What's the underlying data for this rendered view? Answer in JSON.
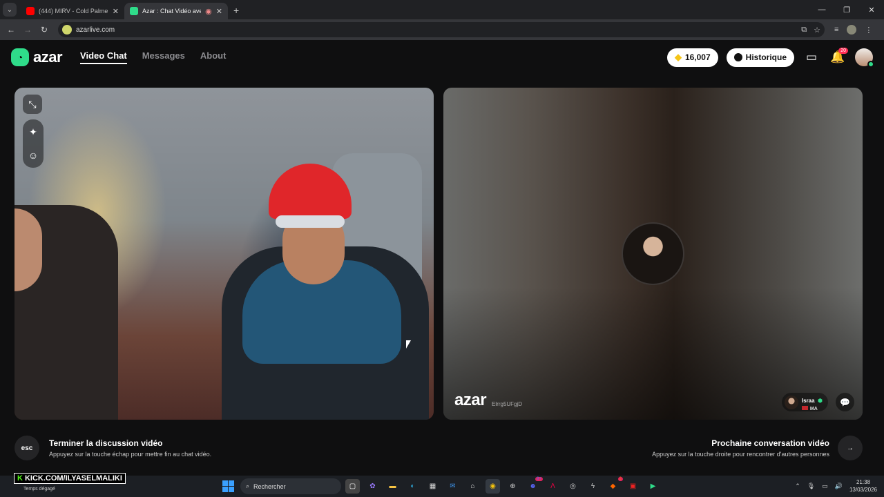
{
  "browser": {
    "tabs": [
      {
        "title": "(444) MIRV - Cold Palmer (offic",
        "icon": "youtube-icon",
        "color": "#ff0000"
      },
      {
        "title": "Azar : Chat Vidéo avec de n",
        "icon": "azar-favicon",
        "color": "#2fdc8a"
      }
    ],
    "url": "azarlive.com"
  },
  "header": {
    "logo": "azar",
    "nav": [
      {
        "label": "Video Chat",
        "active": true
      },
      {
        "label": "Messages",
        "active": false
      },
      {
        "label": "About",
        "active": false
      }
    ],
    "gems": "16,007",
    "history_label": "Historique",
    "notification_count": "20"
  },
  "remote": {
    "watermark": "azar",
    "session_id": "Elrrg5UFgjD",
    "peer_name": "Israa",
    "peer_country": "MA"
  },
  "hints": {
    "esc_key": "esc",
    "end_title": "Terminer la discussion vidéo",
    "end_sub": "Appuyez sur la touche échap pour mettre fin au chat vidéo.",
    "next_title": "Prochaine conversation vidéo",
    "next_sub": "Appuyez sur la touche droite pour rencontrer d'autres personnes"
  },
  "overlay": {
    "kick_channel": "KICK.COM/ILYASELMALIKI",
    "weather": "Temps dégagé"
  },
  "taskbar": {
    "search_placeholder": "Rechercher",
    "time": "21:38",
    "date": "13/03/2026"
  },
  "colors": {
    "accent": "#2fdc8a",
    "badge": "#ff2d55",
    "gem": "#f5c518"
  }
}
